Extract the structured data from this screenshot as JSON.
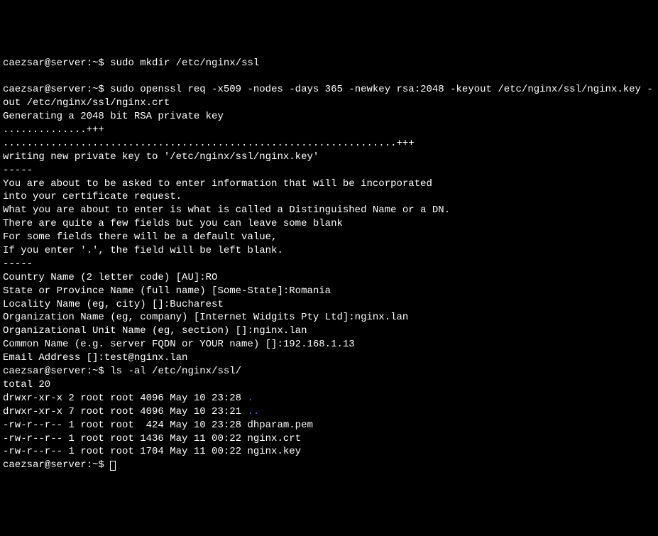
{
  "prompt": "caezsar@server:~$ ",
  "cmd1": "sudo mkdir /etc/nginx/ssl",
  "cmd2": "sudo openssl req -x509 -nodes -days 365 -newkey rsa:2048 -keyout /etc/nginx/ssl/nginx.key -out /etc/nginx/ssl/nginx.crt",
  "out": {
    "l1": "Generating a 2048 bit RSA private key",
    "l2": "..............+++",
    "l3": "..................................................................+++",
    "l4": "writing new private key to '/etc/nginx/ssl/nginx.key'",
    "l5": "-----",
    "l6": "You are about to be asked to enter information that will be incorporated",
    "l7": "into your certificate request.",
    "l8": "What you are about to enter is what is called a Distinguished Name or a DN.",
    "l9": "There are quite a few fields but you can leave some blank",
    "l10": "For some fields there will be a default value,",
    "l11": "If you enter '.', the field will be left blank.",
    "l12": "-----",
    "l13": "Country Name (2 letter code) [AU]:RO",
    "l14": "State or Province Name (full name) [Some-State]:Romania",
    "l15": "Locality Name (eg, city) []:Bucharest",
    "l16": "Organization Name (eg, company) [Internet Widgits Pty Ltd]:nginx.lan",
    "l17": "Organizational Unit Name (eg, section) []:nginx.lan",
    "l18": "Common Name (e.g. server FQDN or YOUR name) []:192.168.1.13",
    "l19": "Email Address []:test@nginx.lan"
  },
  "cmd3": "ls -al /etc/nginx/ssl/",
  "ls": {
    "total": "total 20",
    "r1a": "drwxr-xr-x 2 root root 4096 May 10 23:28 ",
    "r1b": ".",
    "r2a": "drwxr-xr-x 7 root root 4096 May 10 23:21 ",
    "r2b": "..",
    "r3": "-rw-r--r-- 1 root root  424 May 10 23:28 dhparam.pem",
    "r4": "-rw-r--r-- 1 root root 1436 May 11 00:22 nginx.crt",
    "r5": "-rw-r--r-- 1 root root 1704 May 11 00:22 nginx.key"
  }
}
